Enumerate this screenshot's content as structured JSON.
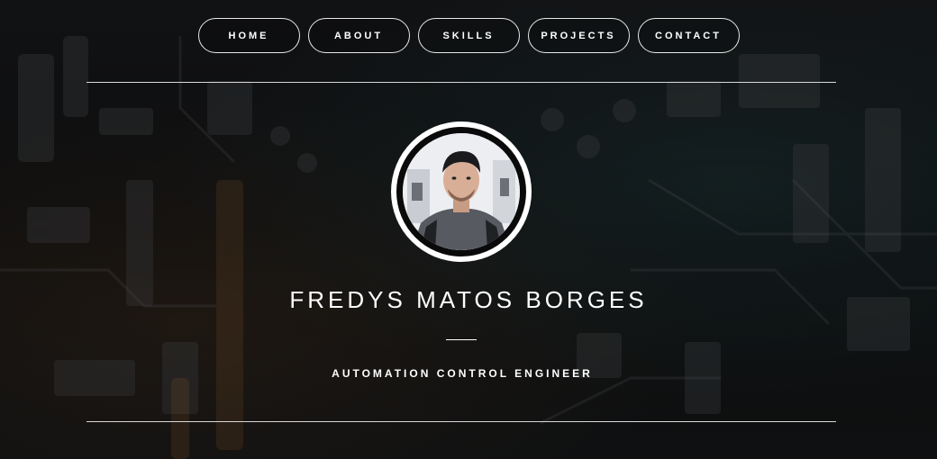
{
  "nav": {
    "items": [
      {
        "label": "HOME"
      },
      {
        "label": "ABOUT"
      },
      {
        "label": "SKILLS"
      },
      {
        "label": "PROJECTS"
      },
      {
        "label": "CONTACT"
      }
    ]
  },
  "profile": {
    "name": "FREDYS MATOS BORGES",
    "title": "AUTOMATION CONTROL ENGINEER"
  },
  "colors": {
    "text": "#ffffff",
    "background": "#0c0d0e",
    "border": "#e8e8e8"
  }
}
